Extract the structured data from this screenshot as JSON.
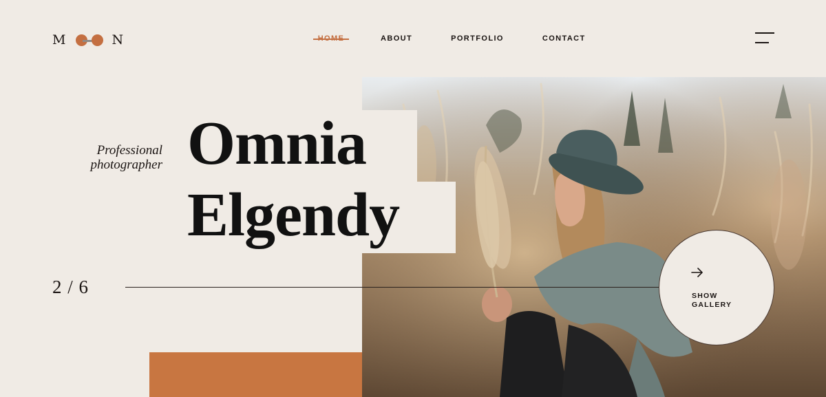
{
  "logo": {
    "letter_left": "M",
    "letter_right": "N",
    "brand_color": "#c46f41"
  },
  "nav": {
    "items": [
      {
        "label": "HOME",
        "active": true
      },
      {
        "label": "ABOUT",
        "active": false
      },
      {
        "label": "PORTFOLIO",
        "active": false
      },
      {
        "label": "CONTACT",
        "active": false
      }
    ],
    "active_color": "#c46f41"
  },
  "menu": {
    "icon": "hamburger-menu-icon"
  },
  "hero": {
    "subtitle_line1": "Professional",
    "subtitle_line2": "photographer",
    "first_name": "Omnia",
    "last_name": "Elgendy",
    "slide_counter": "2 / 6",
    "accent_color": "#c87641",
    "background_color": "#f0ebe5"
  },
  "gallery_button": {
    "line1": "SHOW",
    "line2": "GALLERY",
    "icon": "arrow-right-icon"
  },
  "photo": {
    "description_icon": "portrait-photo"
  }
}
